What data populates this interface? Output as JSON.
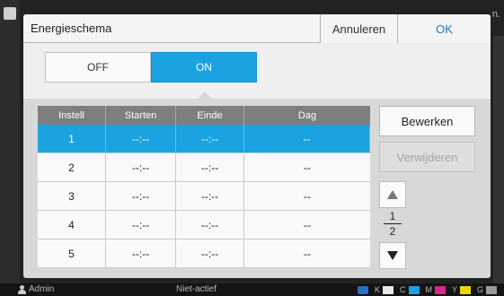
{
  "dialog": {
    "title": "Energieschema",
    "cancel_label": "Annuleren",
    "ok_label": "OK"
  },
  "toggle": {
    "off_label": "OFF",
    "on_label": "ON",
    "selected": "ON"
  },
  "table": {
    "headers": [
      "Instell",
      "Starten",
      "Einde",
      "Dag"
    ],
    "rows": [
      [
        "1",
        "--:--",
        "--:--",
        "--"
      ],
      [
        "2",
        "--:--",
        "--:--",
        "--"
      ],
      [
        "3",
        "--:--",
        "--:--",
        "--"
      ],
      [
        "4",
        "--:--",
        "--:--",
        "--"
      ],
      [
        "5",
        "--:--",
        "--:--",
        "--"
      ]
    ],
    "selected_row": 1
  },
  "actions": {
    "edit_label": "Bewerken",
    "delete_label": "Verwijderen"
  },
  "pagination": {
    "current": "1",
    "total": "2"
  },
  "statusbar": {
    "user": "Admin",
    "status": "Niet-actief",
    "toner_labels": [
      "K",
      "C",
      "M",
      "Y",
      "G"
    ]
  },
  "background": {
    "corner_text": "n."
  },
  "colors": {
    "accent": "#1aa3e0",
    "ok_text": "#1777c2"
  }
}
